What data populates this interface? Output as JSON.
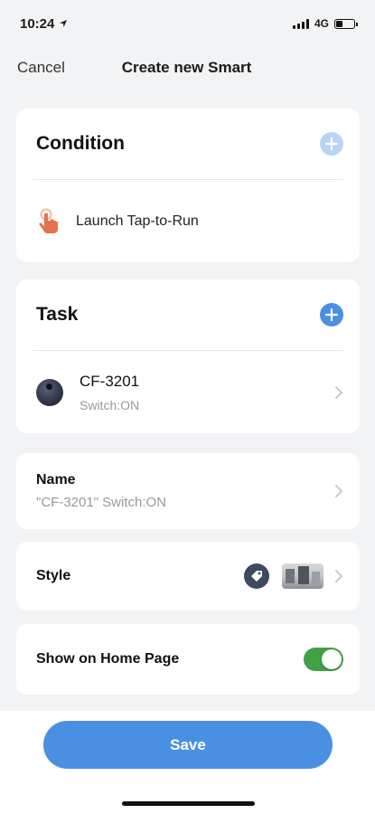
{
  "status_bar": {
    "time": "10:24",
    "network": "4G",
    "signal_icon": "signal-icon",
    "battery_icon": "battery-icon",
    "location_icon": "location-arrow-icon"
  },
  "nav": {
    "cancel_label": "Cancel",
    "title": "Create new Smart"
  },
  "condition": {
    "title": "Condition",
    "add_icon": "plus-circle-icon",
    "item": {
      "icon": "tap-hand-icon",
      "label": "Launch Tap-to-Run"
    }
  },
  "task": {
    "title": "Task",
    "add_icon": "plus-circle-icon",
    "item": {
      "icon": "device-icon",
      "name": "CF-3201",
      "sub": "Switch:ON"
    }
  },
  "name_row": {
    "title": "Name",
    "value": "\"CF-3201\" Switch:ON"
  },
  "style_row": {
    "title": "Style",
    "tag_icon": "tag-icon"
  },
  "show_home": {
    "title": "Show on Home Page",
    "enabled": true
  },
  "save_label": "Save",
  "colors": {
    "accent": "#4a90e2",
    "accent_light": "#b8d4f5",
    "toggle_on": "#43a047",
    "hand_icon": "#e0734f"
  }
}
